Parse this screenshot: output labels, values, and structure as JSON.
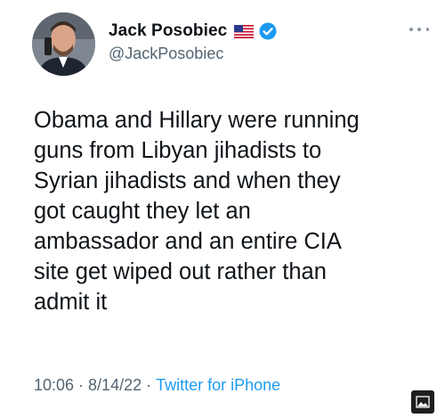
{
  "author": {
    "display_name": "Jack Posobiec",
    "handle": "@JackPosobiec",
    "flag_icon": "us-flag-icon",
    "verified_icon": "verified-badge-icon",
    "verified_color": "#1d9bf0"
  },
  "tweet": {
    "lines": [
      "Obama and Hillary were running",
      "guns from Libyan jihadists to",
      "Syrian jihadists and when they",
      "got caught they let an",
      "ambassador and an entire CIA",
      "site get wiped out rather than",
      "admit it"
    ]
  },
  "meta": {
    "time": "10:06",
    "separator": "·",
    "date": "8/14/22",
    "source": "Twitter for iPhone",
    "source_color": "#1d9bf0"
  },
  "icons": {
    "more": "more-options-icon",
    "image": "image-icon"
  }
}
